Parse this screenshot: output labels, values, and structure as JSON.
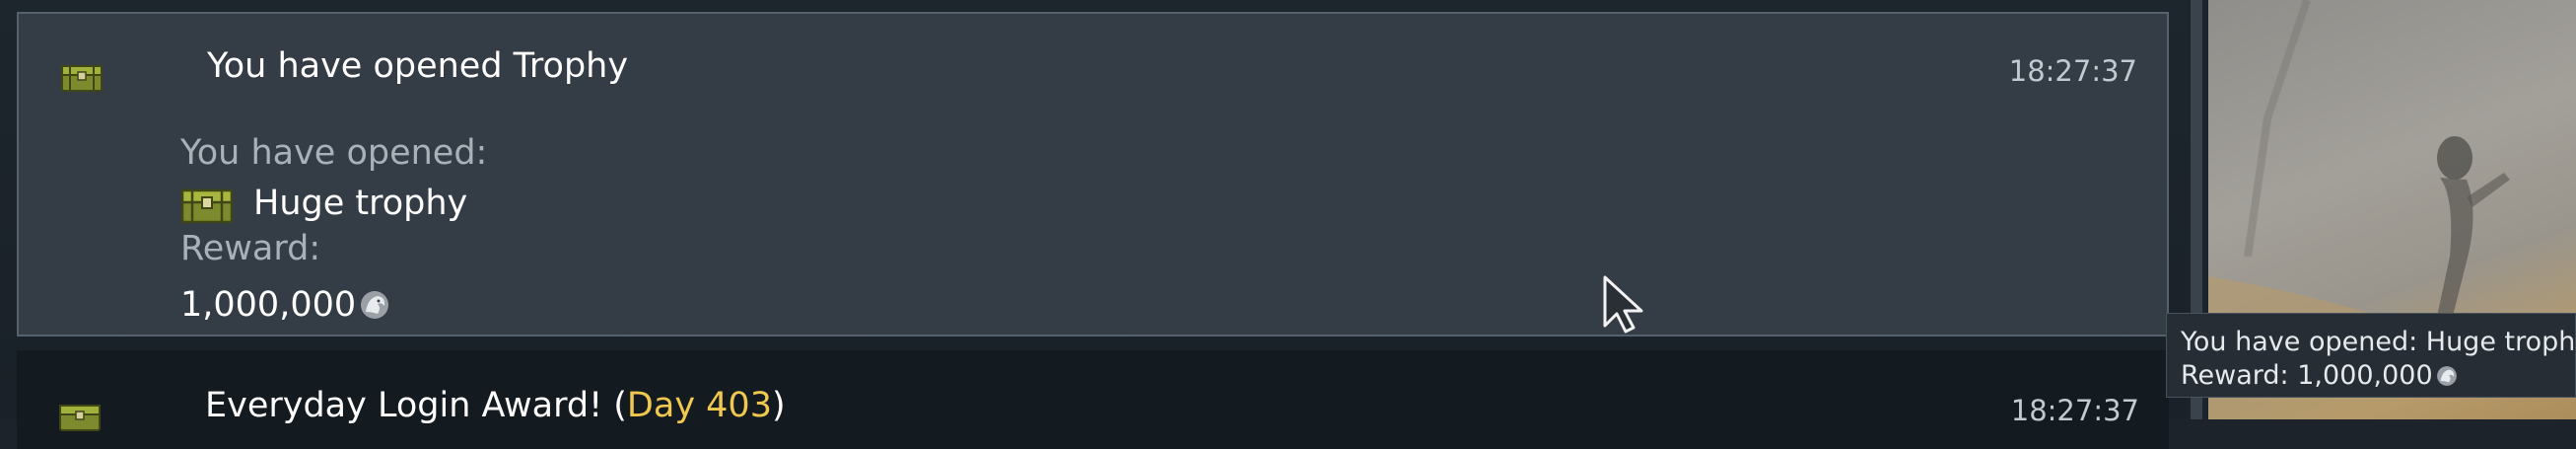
{
  "notifications": [
    {
      "title": "You have opened Trophy",
      "time": "18:27:37",
      "opened_label": "You have opened:",
      "item_name": "Huge trophy",
      "reward_label": "Reward:",
      "reward_value": "1,000,000",
      "icon": "chest-icon",
      "currency_icon": "silver-lion-icon"
    },
    {
      "title_prefix": "Everyday Login Award! (",
      "title_highlight": "Day 403",
      "title_suffix": ")",
      "time": "18:27:37",
      "icon": "chest-icon"
    }
  ],
  "tooltip": {
    "line1": "You have opened: Huge trophy",
    "line2_label": "Reward:",
    "line2_value": "1,000,000",
    "currency_icon": "silver-lion-icon"
  },
  "colors": {
    "selected_bg": "#343c46",
    "highlight": "#f0c850",
    "muted_text": "#a9b1b8"
  }
}
